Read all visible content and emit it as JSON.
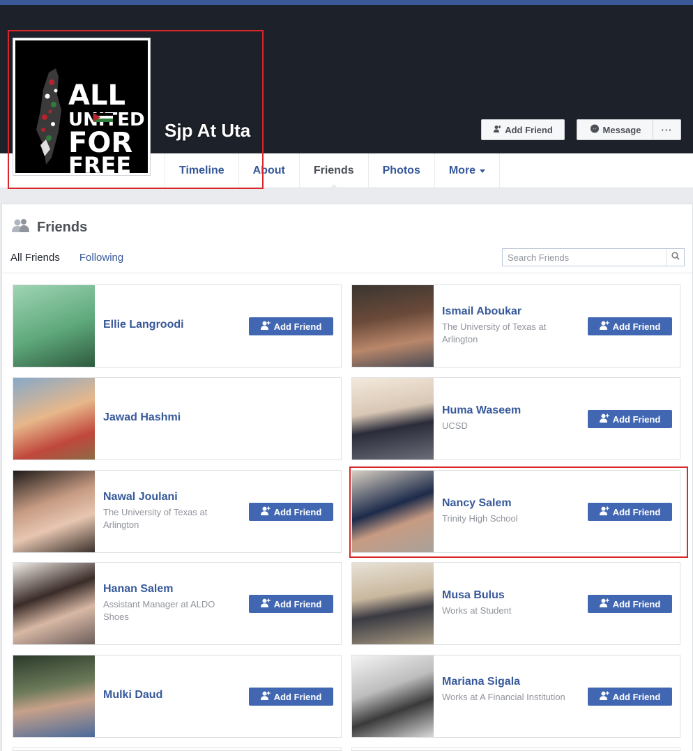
{
  "profile": {
    "name": "Sjp At Uta",
    "logo_text": [
      "ALL",
      "UNITED",
      "FOR",
      "FREE"
    ]
  },
  "cover_actions": {
    "add_friend_label": "Add Friend",
    "message_label": "Message",
    "more_label": "···"
  },
  "nav": {
    "tabs": [
      {
        "label": "Timeline"
      },
      {
        "label": "About"
      },
      {
        "label": "Friends"
      },
      {
        "label": "Photos"
      },
      {
        "label": "More"
      }
    ],
    "active": "Friends"
  },
  "friends_section": {
    "title": "Friends",
    "subtabs": [
      {
        "label": "All Friends"
      },
      {
        "label": "Following"
      }
    ],
    "search_placeholder": "Search Friends"
  },
  "add_friend_label": "Add Friend",
  "friends": [
    {
      "name": "Ellie Langroodi",
      "sub": "",
      "has_button": true
    },
    {
      "name": "Ismail Aboukar",
      "sub": "The University of Texas at Arlington",
      "has_button": true
    },
    {
      "name": "Jawad Hashmi",
      "sub": "",
      "has_button": false
    },
    {
      "name": "Huma Waseem",
      "sub": "UCSD",
      "has_button": true
    },
    {
      "name": "Nawal Joulani",
      "sub": "The University of Texas at Arlington",
      "has_button": true
    },
    {
      "name": "Nancy Salem",
      "sub": "Trinity High School",
      "has_button": true
    },
    {
      "name": "Hanan Salem",
      "sub": "Assistant Manager at ALDO Shoes",
      "has_button": true
    },
    {
      "name": "Musa Bulus",
      "sub": "Works at Student",
      "has_button": true
    },
    {
      "name": "Mulki Daud",
      "sub": "",
      "has_button": true
    },
    {
      "name": "Mariana Sigala",
      "sub": "Works at A Financial Institution",
      "has_button": true
    }
  ],
  "colors": {
    "brand": "#3b5998",
    "button": "#4267b2",
    "link": "#365899",
    "highlight": "#d8262b"
  }
}
